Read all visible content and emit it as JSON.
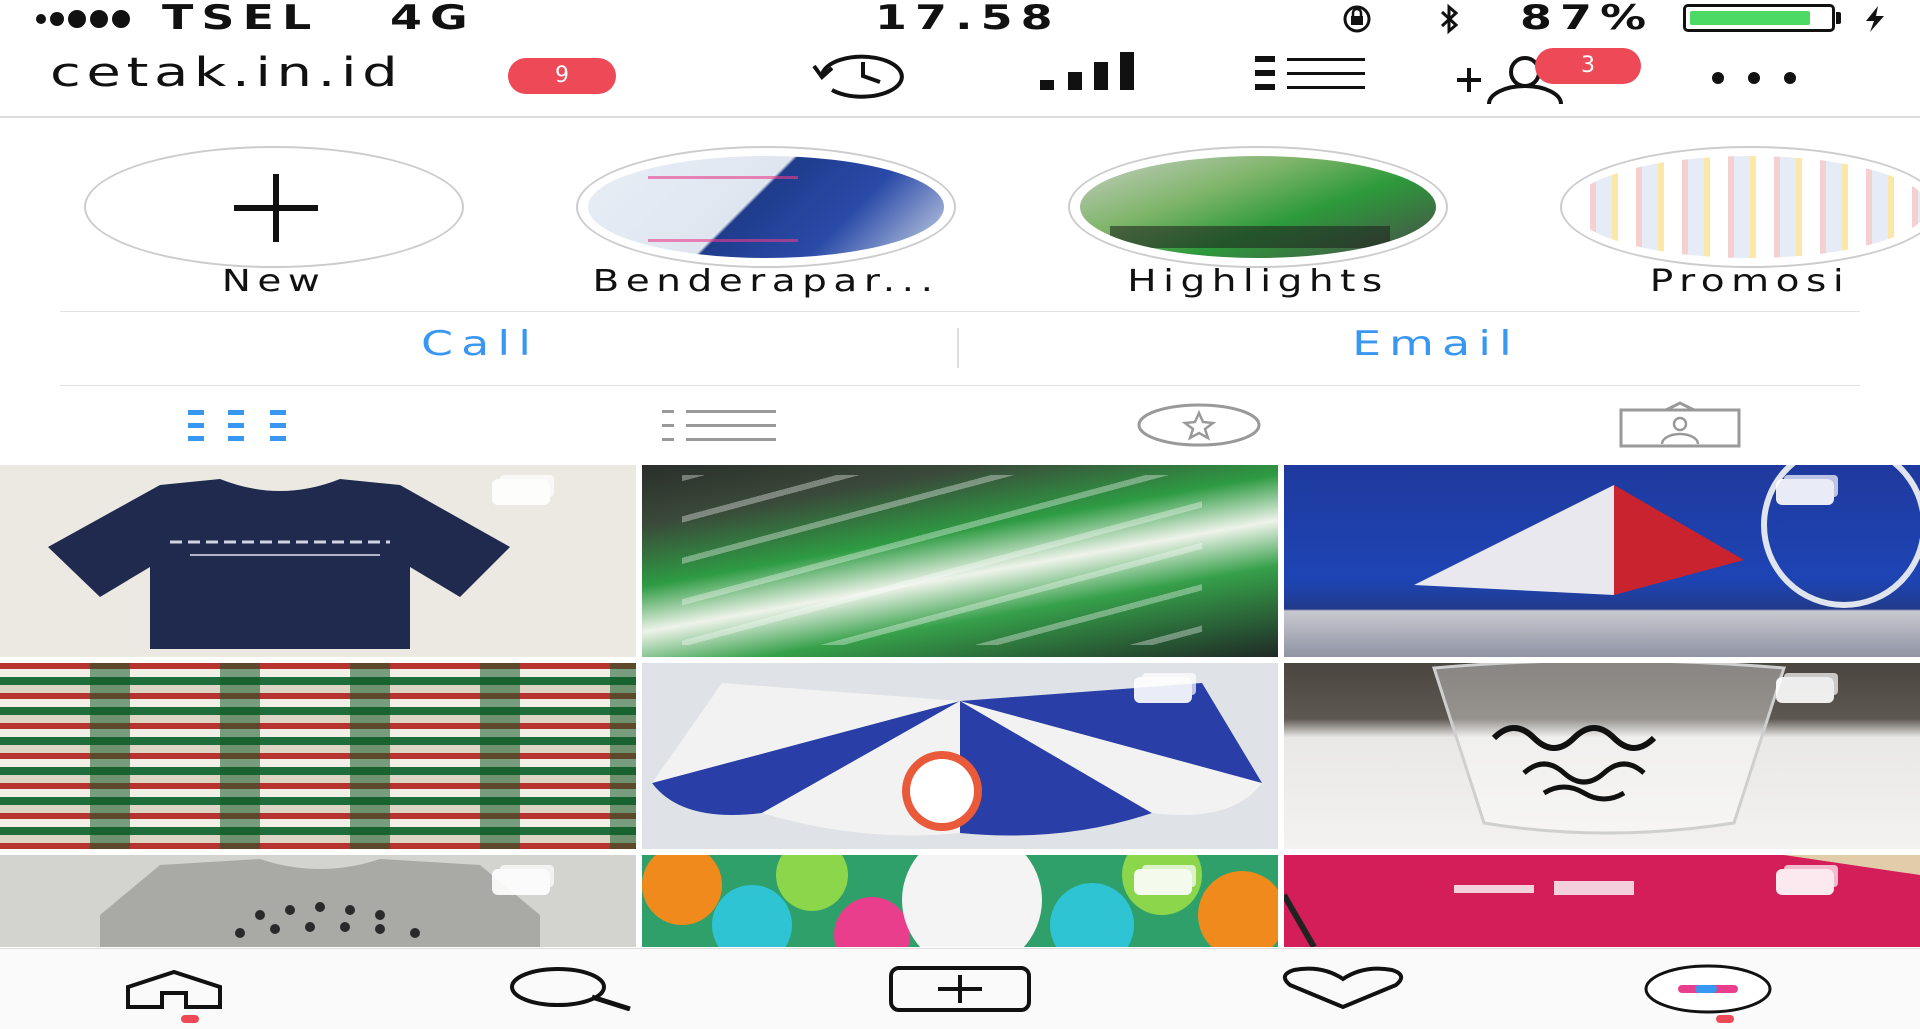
{
  "status_bar": {
    "carrier": "TSEL",
    "network": "4G",
    "time": "17.58",
    "battery_percent": "87%",
    "battery_level": 0.87,
    "battery_color": "#4cd964"
  },
  "header": {
    "username": "cetak.in.id",
    "account_badge": "9",
    "follow_badge": "3",
    "icons": [
      "archive-clock-icon",
      "insights-bar-icon",
      "saved-list-icon",
      "add-person-icon",
      "more-dots-icon"
    ]
  },
  "highlights": [
    {
      "label": "New"
    },
    {
      "label": "Benderapar..."
    },
    {
      "label": "Highlights"
    },
    {
      "label": "Promosi"
    }
  ],
  "actions": {
    "call": "Call",
    "email": "Email"
  },
  "tabs": [
    "grid-view-icon",
    "list-view-icon",
    "tagged-star-icon",
    "profile-tag-icon"
  ],
  "posts": [
    {
      "name": "post-navy-tshirt"
    },
    {
      "name": "post-green-books"
    },
    {
      "name": "post-demokrat-banner"
    },
    {
      "name": "post-green-stacked-books"
    },
    {
      "name": "post-umbrella"
    },
    {
      "name": "post-plastic-cup"
    },
    {
      "name": "post-grey-tshirt"
    },
    {
      "name": "post-colorful-balls"
    },
    {
      "name": "post-pink-notebook"
    }
  ],
  "bottom_nav": [
    "home-icon",
    "search-icon",
    "add-post-icon",
    "heart-icon",
    "profile-avatar-icon"
  ],
  "colors": {
    "accent_blue": "#3897f0",
    "badge_red": "#ed4956"
  }
}
